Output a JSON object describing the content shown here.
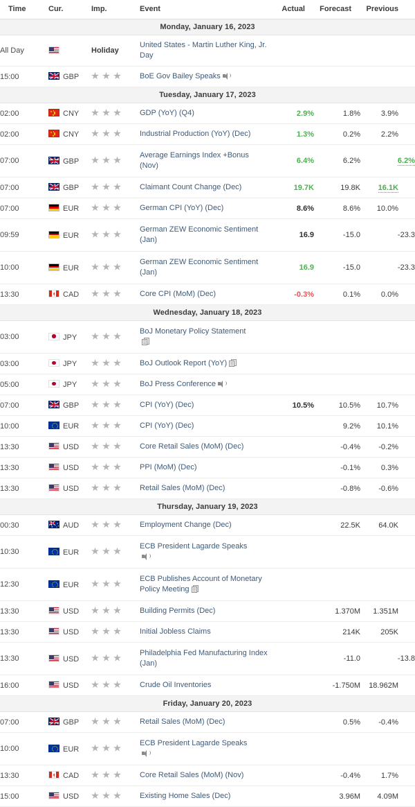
{
  "header": {
    "time": "Time",
    "currency": "Cur.",
    "importance": "Imp.",
    "event": "Event",
    "actual": "Actual",
    "forecast": "Forecast",
    "previous": "Previous"
  },
  "colors": {
    "up": "#4caf50",
    "down": "#f05050",
    "event_link": "#3f5a78",
    "day_header_bg": "#f3f3f3",
    "star": "#b4b4b4"
  },
  "days": [
    {
      "label": "Monday, January 16, 2023",
      "rows": [
        {
          "time": "All Day",
          "flag": "us",
          "currency": "",
          "importance_text": "Holiday",
          "event": "United States - Martin Luther King, Jr. Day",
          "actual": "",
          "forecast": "",
          "previous": "",
          "actual_state": "none",
          "previous_state": "none",
          "icon": ""
        },
        {
          "time": "15:00",
          "flag": "gb",
          "currency": "GBP",
          "stars": 3,
          "event": "BoE Gov Bailey Speaks",
          "actual": "",
          "forecast": "",
          "previous": "",
          "actual_state": "none",
          "previous_state": "none",
          "icon": "speaker-icon"
        }
      ]
    },
    {
      "label": "Tuesday, January 17, 2023",
      "rows": [
        {
          "time": "02:00",
          "flag": "cn",
          "currency": "CNY",
          "stars": 3,
          "event": "GDP (YoY) (Q4)",
          "actual": "2.9%",
          "forecast": "1.8%",
          "previous": "3.9%",
          "actual_state": "up",
          "previous_state": "plain",
          "icon": ""
        },
        {
          "time": "02:00",
          "flag": "cn",
          "currency": "CNY",
          "stars": 3,
          "event": "Industrial Production (YoY) (Dec)",
          "actual": "1.3%",
          "forecast": "0.2%",
          "previous": "2.2%",
          "actual_state": "up",
          "previous_state": "plain",
          "icon": ""
        },
        {
          "time": "07:00",
          "flag": "gb",
          "currency": "GBP",
          "stars": 3,
          "event": "Average Earnings Index +Bonus (Nov)",
          "actual": "6.4%",
          "forecast": "6.2%",
          "previous": "6.2%",
          "actual_state": "up",
          "previous_state": "revised",
          "icon": "",
          "tall": true
        },
        {
          "time": "07:00",
          "flag": "gb",
          "currency": "GBP",
          "stars": 3,
          "event": "Claimant Count Change (Dec)",
          "actual": "19.7K",
          "forecast": "19.8K",
          "previous": "16.1K",
          "actual_state": "up",
          "previous_state": "revised",
          "icon": ""
        },
        {
          "time": "07:00",
          "flag": "de",
          "currency": "EUR",
          "stars": 3,
          "event": "German CPI (YoY) (Dec)",
          "actual": "8.6%",
          "forecast": "8.6%",
          "previous": "10.0%",
          "actual_state": "bold",
          "previous_state": "plain",
          "icon": ""
        },
        {
          "time": "09:59",
          "flag": "de",
          "currency": "EUR",
          "stars": 3,
          "event": "German ZEW Economic Sentiment (Jan)",
          "actual": "16.9",
          "forecast": "-15.0",
          "previous": "-23.3",
          "actual_state": "bold",
          "previous_state": "plain",
          "icon": "",
          "tall": true
        },
        {
          "time": "10:00",
          "flag": "de",
          "currency": "EUR",
          "stars": 3,
          "event": "German ZEW Economic Sentiment (Jan)",
          "actual": "16.9",
          "forecast": "-15.0",
          "previous": "-23.3",
          "actual_state": "up",
          "previous_state": "plain",
          "icon": "",
          "tall": true
        },
        {
          "time": "13:30",
          "flag": "ca",
          "currency": "CAD",
          "stars": 3,
          "event": "Core CPI (MoM) (Dec)",
          "actual": "-0.3%",
          "forecast": "0.1%",
          "previous": "0.0%",
          "actual_state": "down",
          "previous_state": "plain",
          "icon": ""
        }
      ]
    },
    {
      "label": "Wednesday, January 18, 2023",
      "rows": [
        {
          "time": "03:00",
          "flag": "jp",
          "currency": "JPY",
          "stars": 3,
          "event": "BoJ Monetary Policy Statement",
          "actual": "",
          "forecast": "",
          "previous": "",
          "actual_state": "none",
          "previous_state": "none",
          "icon": "document-icon",
          "icon_newline": true,
          "tall": true
        },
        {
          "time": "03:00",
          "flag": "jp",
          "currency": "JPY",
          "stars": 3,
          "event": "BoJ Outlook Report (YoY)",
          "actual": "",
          "forecast": "",
          "previous": "",
          "actual_state": "none",
          "previous_state": "none",
          "icon": "document-icon"
        },
        {
          "time": "05:00",
          "flag": "jp",
          "currency": "JPY",
          "stars": 3,
          "event": "BoJ Press Conference",
          "actual": "",
          "forecast": "",
          "previous": "",
          "actual_state": "none",
          "previous_state": "none",
          "icon": "speaker-icon"
        },
        {
          "time": "07:00",
          "flag": "gb",
          "currency": "GBP",
          "stars": 3,
          "event": "CPI (YoY) (Dec)",
          "actual": "10.5%",
          "forecast": "10.5%",
          "previous": "10.7%",
          "actual_state": "bold",
          "previous_state": "plain",
          "icon": ""
        },
        {
          "time": "10:00",
          "flag": "eu",
          "currency": "EUR",
          "stars": 3,
          "event": "CPI (YoY) (Dec)",
          "actual": "",
          "forecast": "9.2%",
          "previous": "10.1%",
          "actual_state": "none",
          "previous_state": "plain",
          "icon": ""
        },
        {
          "time": "13:30",
          "flag": "us",
          "currency": "USD",
          "stars": 3,
          "event": "Core Retail Sales (MoM) (Dec)",
          "actual": "",
          "forecast": "-0.4%",
          "previous": "-0.2%",
          "actual_state": "none",
          "previous_state": "plain",
          "icon": ""
        },
        {
          "time": "13:30",
          "flag": "us",
          "currency": "USD",
          "stars": 3,
          "event": "PPI (MoM) (Dec)",
          "actual": "",
          "forecast": "-0.1%",
          "previous": "0.3%",
          "actual_state": "none",
          "previous_state": "plain",
          "icon": ""
        },
        {
          "time": "13:30",
          "flag": "us",
          "currency": "USD",
          "stars": 3,
          "event": "Retail Sales (MoM) (Dec)",
          "actual": "",
          "forecast": "-0.8%",
          "previous": "-0.6%",
          "actual_state": "none",
          "previous_state": "plain",
          "icon": ""
        }
      ]
    },
    {
      "label": "Thursday, January 19, 2023",
      "rows": [
        {
          "time": "00:30",
          "flag": "au",
          "currency": "AUD",
          "stars": 3,
          "event": "Employment Change (Dec)",
          "actual": "",
          "forecast": "22.5K",
          "previous": "64.0K",
          "actual_state": "none",
          "previous_state": "plain",
          "icon": ""
        },
        {
          "time": "10:30",
          "flag": "eu",
          "currency": "EUR",
          "stars": 3,
          "event": "ECB President Lagarde Speaks",
          "actual": "",
          "forecast": "",
          "previous": "",
          "actual_state": "none",
          "previous_state": "none",
          "icon": "speaker-icon",
          "icon_newline": true,
          "tall": true
        },
        {
          "time": "12:30",
          "flag": "eu",
          "currency": "EUR",
          "stars": 3,
          "event": "ECB Publishes Account of Monetary Policy Meeting",
          "actual": "",
          "forecast": "",
          "previous": "",
          "actual_state": "none",
          "previous_state": "none",
          "icon": "document-icon",
          "tall": true
        },
        {
          "time": "13:30",
          "flag": "us",
          "currency": "USD",
          "stars": 3,
          "event": "Building Permits (Dec)",
          "actual": "",
          "forecast": "1.370M",
          "previous": "1.351M",
          "actual_state": "none",
          "previous_state": "plain",
          "icon": ""
        },
        {
          "time": "13:30",
          "flag": "us",
          "currency": "USD",
          "stars": 3,
          "event": "Initial Jobless Claims",
          "actual": "",
          "forecast": "214K",
          "previous": "205K",
          "actual_state": "none",
          "previous_state": "plain",
          "icon": ""
        },
        {
          "time": "13:30",
          "flag": "us",
          "currency": "USD",
          "stars": 3,
          "event": "Philadelphia Fed Manufacturing Index (Jan)",
          "actual": "",
          "forecast": "-11.0",
          "previous": "-13.8",
          "actual_state": "none",
          "previous_state": "plain",
          "icon": "",
          "tall": true
        },
        {
          "time": "16:00",
          "flag": "us",
          "currency": "USD",
          "stars": 3,
          "event": "Crude Oil Inventories",
          "actual": "",
          "forecast": "-1.750M",
          "previous": "18.962M",
          "actual_state": "none",
          "previous_state": "plain",
          "icon": ""
        }
      ]
    },
    {
      "label": "Friday, January 20, 2023",
      "rows": [
        {
          "time": "07:00",
          "flag": "gb",
          "currency": "GBP",
          "stars": 3,
          "event": "Retail Sales (MoM) (Dec)",
          "actual": "",
          "forecast": "0.5%",
          "previous": "-0.4%",
          "actual_state": "none",
          "previous_state": "plain",
          "icon": ""
        },
        {
          "time": "10:00",
          "flag": "eu",
          "currency": "EUR",
          "stars": 3,
          "event": "ECB President Lagarde Speaks",
          "actual": "",
          "forecast": "",
          "previous": "",
          "actual_state": "none",
          "previous_state": "none",
          "icon": "speaker-icon",
          "icon_newline": true,
          "tall": true
        },
        {
          "time": "13:30",
          "flag": "ca",
          "currency": "CAD",
          "stars": 3,
          "event": "Core Retail Sales (MoM) (Nov)",
          "actual": "",
          "forecast": "-0.4%",
          "previous": "1.7%",
          "actual_state": "none",
          "previous_state": "plain",
          "icon": ""
        },
        {
          "time": "15:00",
          "flag": "us",
          "currency": "USD",
          "stars": 3,
          "event": "Existing Home Sales (Dec)",
          "actual": "",
          "forecast": "3.96M",
          "previous": "4.09M",
          "actual_state": "none",
          "previous_state": "plain",
          "icon": ""
        }
      ]
    }
  ]
}
